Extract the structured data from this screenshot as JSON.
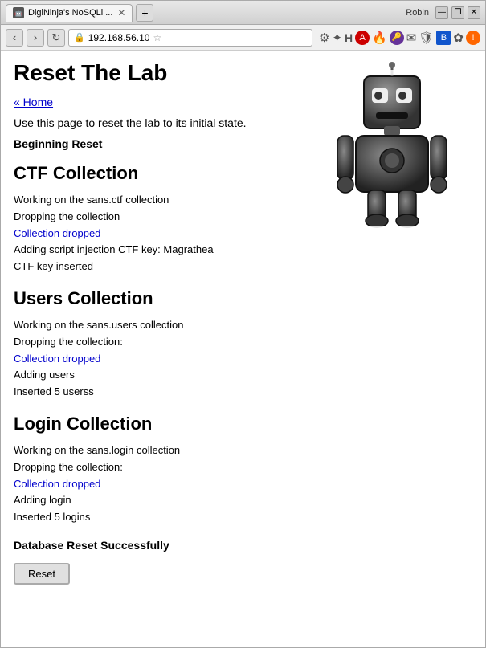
{
  "browser": {
    "user": "Robin",
    "tab_label": "DigiNinja's NoSQLi ...",
    "tab_icon": "🤖",
    "address": "192.168.56.10",
    "nav_back": "‹",
    "nav_forward": "›",
    "nav_refresh": "↻",
    "new_tab": "+",
    "win_minimize": "—",
    "win_restore": "❐",
    "win_close": "✕"
  },
  "page": {
    "title": "Reset The Lab",
    "home_link": "« Home",
    "intro": "Use this page to reset the lab to its initial state.",
    "beginning_reset": "Beginning Reset",
    "ctf_section": "CTF Collection",
    "ctf_lines": [
      {
        "text": "Working on the sans.ctf collection",
        "blue": false
      },
      {
        "text": "Dropping the collection",
        "blue": false
      },
      {
        "text": "Collection dropped",
        "blue": true
      },
      {
        "text": "Adding script injection CTF key: Magrathea",
        "blue": false
      },
      {
        "text": "CTF key inserted",
        "blue": false
      }
    ],
    "users_section": "Users Collection",
    "users_lines": [
      {
        "text": "Working on the sans.users collection",
        "blue": false
      },
      {
        "text": "Dropping the collection:",
        "blue": false
      },
      {
        "text": "Collection dropped",
        "blue": true
      },
      {
        "text": "Adding users",
        "blue": false
      },
      {
        "text": "Inserted 5 userss",
        "blue": false
      }
    ],
    "login_section": "Login Collection",
    "login_lines": [
      {
        "text": "Working on the sans.login collection",
        "blue": false
      },
      {
        "text": "Dropping the collection:",
        "blue": false
      },
      {
        "text": "Collection dropped",
        "blue": true
      },
      {
        "text": "Adding login",
        "blue": false
      },
      {
        "text": "Inserted 5 logins",
        "blue": false
      }
    ],
    "db_reset_success": "Database Reset Successfully",
    "reset_button": "Reset"
  }
}
